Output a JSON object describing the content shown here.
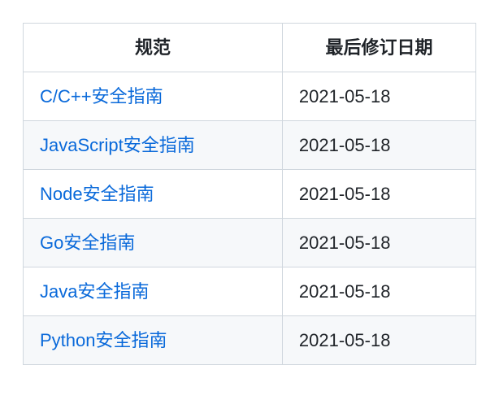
{
  "table": {
    "headers": {
      "spec": "规范",
      "date": "最后修订日期"
    },
    "rows": [
      {
        "name": "C/C++安全指南",
        "date": "2021-05-18"
      },
      {
        "name": "JavaScript安全指南",
        "date": "2021-05-18"
      },
      {
        "name": "Node安全指南",
        "date": "2021-05-18"
      },
      {
        "name": "Go安全指南",
        "date": "2021-05-18"
      },
      {
        "name": "Java安全指南",
        "date": "2021-05-18"
      },
      {
        "name": "Python安全指南",
        "date": "2021-05-18"
      }
    ]
  }
}
